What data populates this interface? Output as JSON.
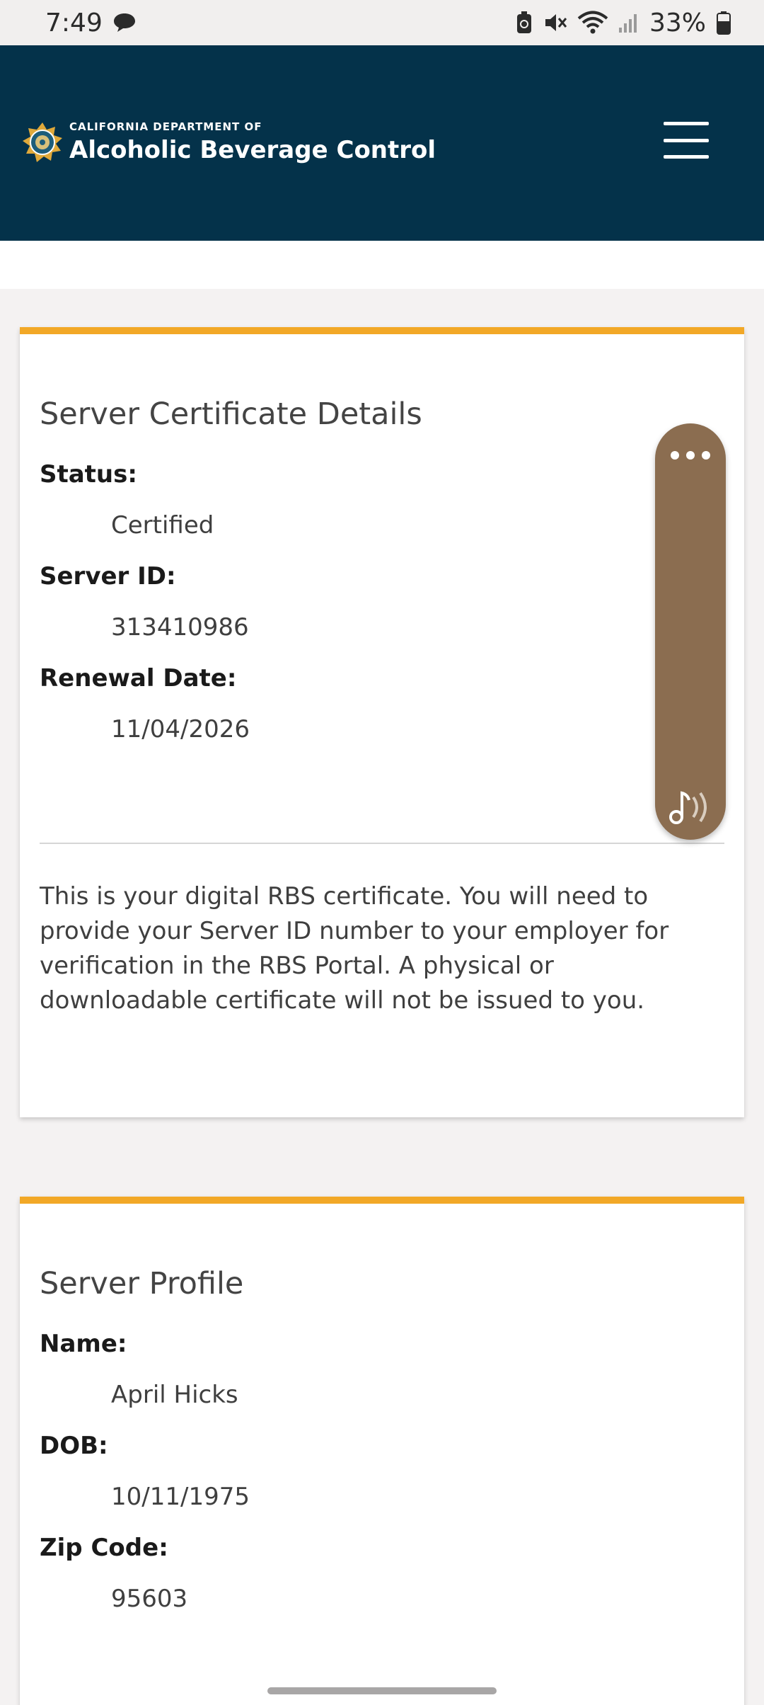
{
  "status_bar": {
    "time": "7:49",
    "battery": "33%",
    "icons": [
      "chat-bubble-icon",
      "battery-saver-icon",
      "mute-icon",
      "wifi-icon",
      "signal-icon",
      "battery-icon"
    ]
  },
  "header": {
    "logo_small": "CALIFORNIA DEPARTMENT OF",
    "logo_big": "Alcoholic Beverage Control",
    "menu_icon": "hamburger-menu-icon"
  },
  "certificate": {
    "title": "Server Certificate Details",
    "fields": [
      {
        "label": "Status:",
        "value": "Certified"
      },
      {
        "label": "Server ID:",
        "value": "313410986"
      },
      {
        "label": "Renewal Date:",
        "value": "11/04/2026"
      }
    ],
    "note": "This is your digital RBS certificate. You will need to provide your Server ID number to your employer for verification in the RBS Portal. A physical or downloadable certificate will not be issued to you."
  },
  "profile": {
    "title": "Server Profile",
    "fields": [
      {
        "label": "Name:",
        "value": "April Hicks"
      },
      {
        "label": "DOB:",
        "value": "10/11/1975"
      },
      {
        "label": "Zip Code:",
        "value": "95603"
      }
    ]
  },
  "colors": {
    "header_bg": "#04324a",
    "accent": "#f2a827",
    "widget_bg": "#8b6d50",
    "page_bg": "#f4f2f2"
  }
}
